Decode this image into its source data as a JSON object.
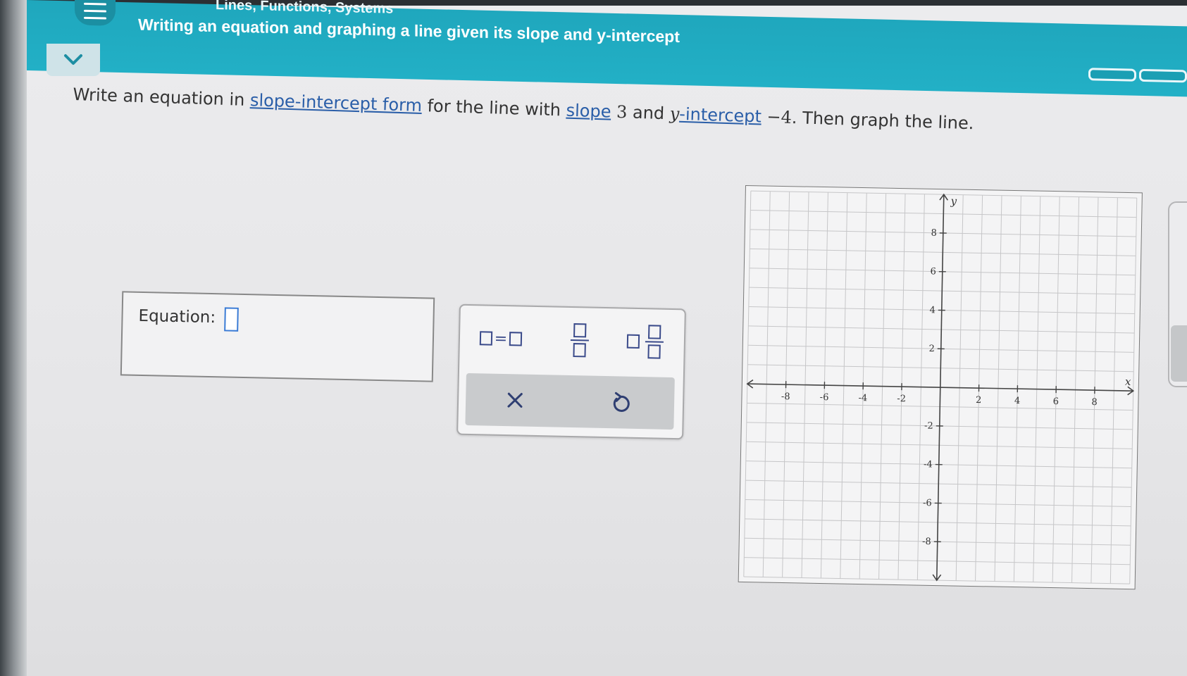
{
  "header": {
    "breadcrumb": "Lines, Functions, Systems",
    "title": "Writing an equation and graphing a line given its slope and y-intercept"
  },
  "question": {
    "part1": "Write an equation in ",
    "link_form": "slope-intercept form",
    "part2": " for the line with ",
    "link_slope": "slope",
    "slope_value": "3",
    "part3": " and ",
    "y_var": "y",
    "link_intercept": "-intercept",
    "intercept_value": "−4",
    "part4": ". Then graph the line."
  },
  "answer": {
    "label": "Equation:",
    "value": ""
  },
  "keypad": {
    "equals_key": "=",
    "clear_icon": "x-icon",
    "undo_icon": "undo-icon"
  },
  "graph": {
    "x_label": "x",
    "y_label": "y",
    "range": [
      -10,
      10
    ],
    "grid_step": 1,
    "x_tick_labels": [
      "-8",
      "-6",
      "-4",
      "-2",
      "2",
      "4",
      "6",
      "8"
    ],
    "y_tick_labels": [
      "8",
      "6",
      "4",
      "2",
      "-2",
      "-4",
      "-6",
      "-8"
    ],
    "tick_values": [
      -8,
      -6,
      -4,
      -2,
      2,
      4,
      6,
      8
    ]
  },
  "colors": {
    "header": "#22b0c6",
    "link": "#2a5ea8",
    "input_border": "#3a7bd5",
    "keypad_glyph": "#3a4a8a"
  }
}
